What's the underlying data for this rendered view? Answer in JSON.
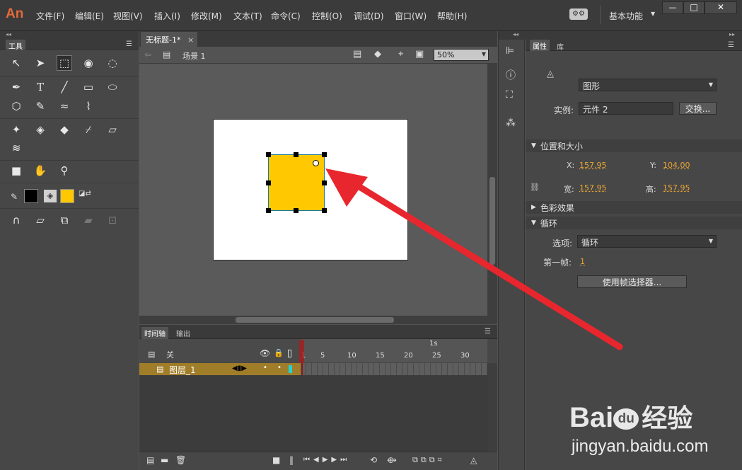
{
  "app": {
    "logo": "An"
  },
  "menu": [
    "文件(F)",
    "编辑(E)",
    "视图(V)",
    "插入(I)",
    "修改(M)",
    "文本(T)",
    "命令(C)",
    "控制(O)",
    "调试(D)",
    "窗口(W)",
    "帮助(H)"
  ],
  "workspace": "基本功能",
  "window_controls": [
    "—",
    "□",
    "✕"
  ],
  "tools_panel": {
    "title": "工具"
  },
  "document": {
    "tab": "无标题-1*",
    "close": "×",
    "scene": "场景 1",
    "zoom": "50%"
  },
  "timeline": {
    "tabs": [
      "时间轴",
      "输出"
    ],
    "header_layer": "关",
    "layer_name": "图层_1",
    "second_mark": "1s",
    "frame_numbers": [
      "1",
      "5",
      "10",
      "15",
      "20",
      "25",
      "30"
    ]
  },
  "properties": {
    "tabs": [
      "属性",
      "库"
    ],
    "type_select": "图形",
    "instance_label": "实例:",
    "instance_value": "元件 2",
    "swap_button": "交换...",
    "position_section": "位置和大小",
    "x_label": "X:",
    "x_value": "157.95",
    "y_label": "Y:",
    "y_value": "104.00",
    "w_label": "宽:",
    "w_value": "157.95",
    "h_label": "高:",
    "h_value": "157.95",
    "color_section": "色彩效果",
    "loop_section": "循环",
    "option_label": "选项:",
    "option_value": "循环",
    "first_frame_label": "第一帧:",
    "first_frame_value": "1",
    "frame_picker_button": "使用帧选择器..."
  },
  "colors": {
    "stroke": "#000000",
    "fill": "#ffc800",
    "accent": "#e8a534",
    "arrow": "#e8262d",
    "layer_highlight": "#a07d28"
  },
  "watermark": {
    "brand": "Bai",
    "brand2": "du",
    "cn": "经验",
    "url": "jingyan.baidu.com"
  }
}
